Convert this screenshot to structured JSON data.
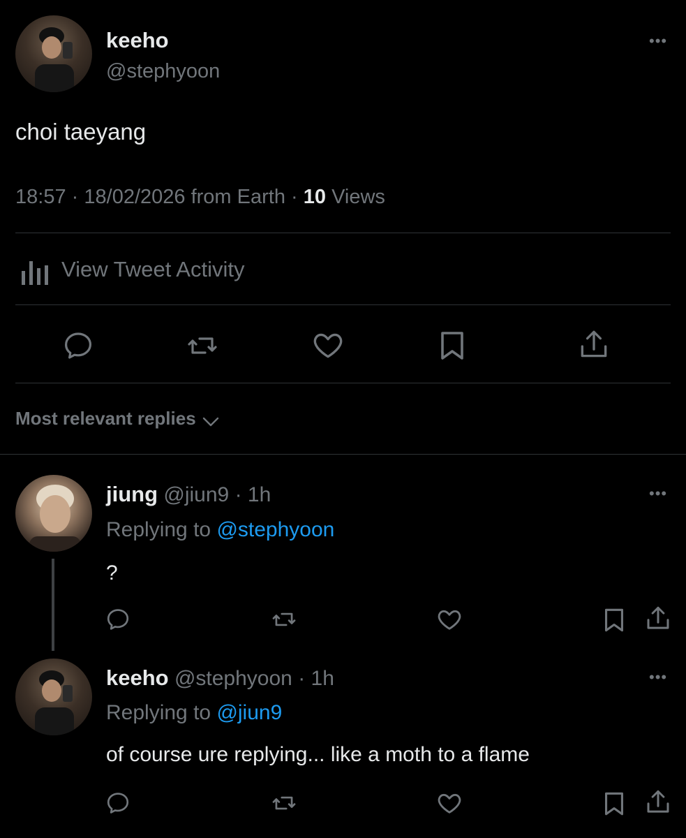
{
  "main_tweet": {
    "author_name": "keeho",
    "author_handle": "@stephyoon",
    "text": "choi taeyang",
    "time": "18:57",
    "date": "18/02/2026",
    "location": "from Earth",
    "sep": "·",
    "views_count": "10",
    "views_label": "Views",
    "activity_label": "View Tweet Activity"
  },
  "sort": {
    "label": "Most relevant replies"
  },
  "replies": [
    {
      "author_name": "jiung",
      "author_handle": "@jiun9",
      "time": "1h",
      "replying_prefix": "Replying to",
      "replying_to": "@stephyoon",
      "text": "?"
    },
    {
      "author_name": "keeho",
      "author_handle": "@stephyoon",
      "time": "1h",
      "replying_prefix": "Replying to",
      "replying_to": "@jiun9",
      "text": "of course ure replying... like a moth to a flame"
    }
  ],
  "icons": {
    "reply": "reply-icon",
    "retweet": "retweet-icon",
    "like": "heart-icon",
    "bookmark": "bookmark-icon",
    "share": "share-icon",
    "more": "more-icon",
    "activity": "activity-chart-icon"
  },
  "colors": {
    "background": "#000000",
    "text": "#e7e9ea",
    "muted": "#71767b",
    "link": "#1d9bf0",
    "divider": "#2f3336"
  }
}
